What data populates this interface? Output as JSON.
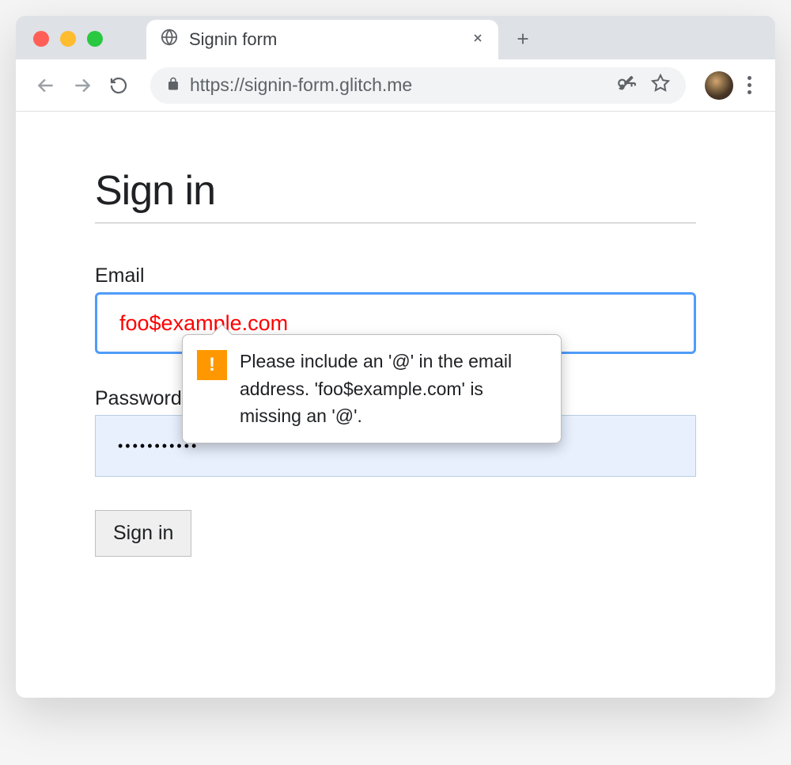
{
  "browser": {
    "tab_title": "Signin form",
    "url": "https://signin-form.glitch.me"
  },
  "page": {
    "heading": "Sign in",
    "email_label": "Email",
    "email_value": "foo$example.com",
    "password_label": "Password",
    "password_value": "•••••••••••",
    "submit_label": "Sign in",
    "validation_message": "Please include an '@' in the email address. 'foo$example.com' is missing an '@'."
  }
}
